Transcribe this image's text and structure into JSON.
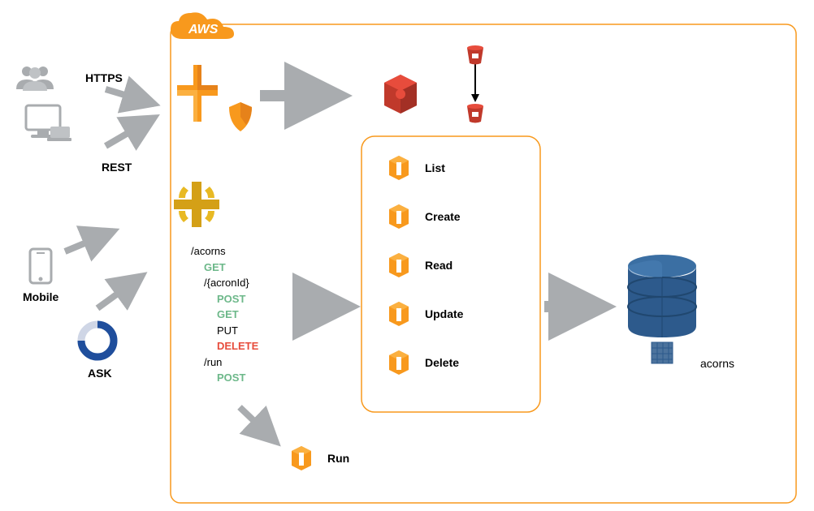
{
  "cloud": {
    "label": "AWS"
  },
  "clients": {
    "https": "HTTPS",
    "rest": "REST",
    "mobile": "Mobile",
    "ask": "ASK"
  },
  "api": {
    "path1": "/acorns",
    "get1": "GET",
    "path2": "/{acronId}",
    "post1": "POST",
    "get2": "GET",
    "put": "PUT",
    "delete": "DELETE",
    "path3": "/run",
    "post2": "POST"
  },
  "lambdas": {
    "list": "List",
    "create": "Create",
    "read": "Read",
    "update": "Update",
    "delete": "Delete",
    "run": "Run"
  },
  "db": {
    "table": "acorns"
  }
}
